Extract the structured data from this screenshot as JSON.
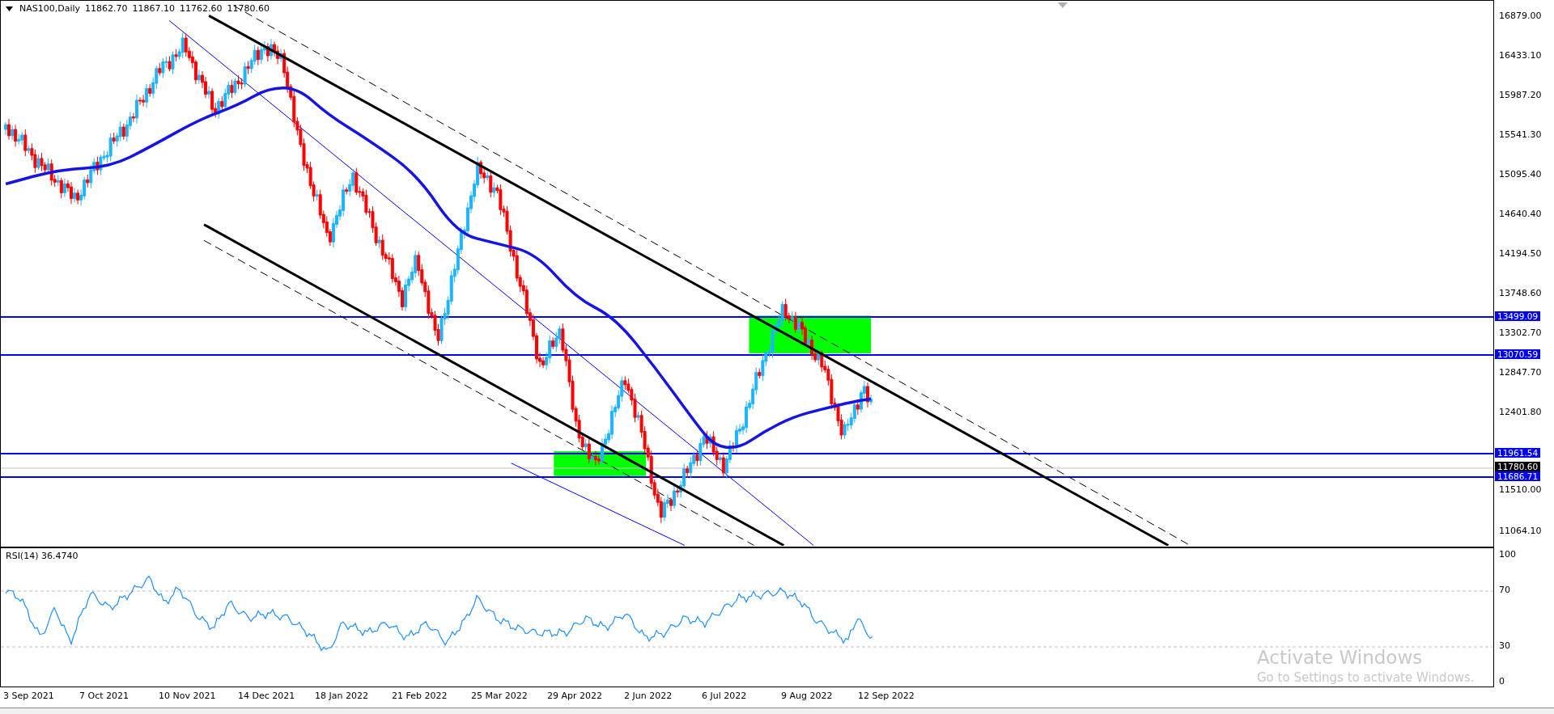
{
  "chart": {
    "symbol": "NAS100,Daily",
    "ohlc": [
      "11862.70",
      "11867.10",
      "11762.60",
      "11780.60"
    ],
    "price_axis": [
      "16879.00",
      "16433.10",
      "15987.20",
      "15541.30",
      "15095.40",
      "14640.40",
      "14194.50",
      "13748.60",
      "13302.70",
      "12847.70",
      "12401.80",
      "11510.00",
      "11064.10"
    ],
    "levels": [
      {
        "label": "13499.09"
      },
      {
        "label": "13070.59"
      },
      {
        "label": "11961.54"
      },
      {
        "label": "11686.71"
      }
    ],
    "current_price": "11780.60"
  },
  "rsi": {
    "label": "RSI(14) 36.4740",
    "axis": [
      "100",
      "70",
      "30",
      "0"
    ]
  },
  "time_axis": [
    "3 Sep 2021",
    "7 Oct 2021",
    "10 Nov 2021",
    "14 Dec 2021",
    "18 Jan 2022",
    "21 Feb 2022",
    "25 Mar 2022",
    "29 Apr 2022",
    "2 Jun 2022",
    "6 Jul 2022",
    "9 Aug 2022",
    "12 Sep 2022"
  ],
  "os_notice": {
    "title": "Activate Windows",
    "subtitle": "Go to Settings to activate Windows."
  }
}
